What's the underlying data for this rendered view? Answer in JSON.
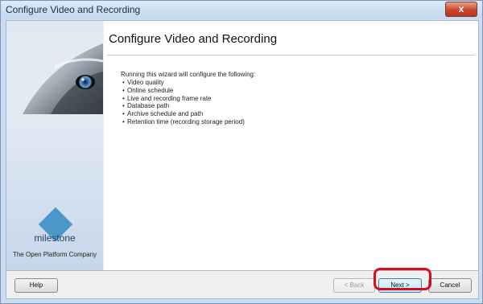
{
  "window": {
    "title": "Configure Video and Recording",
    "close_label": "x"
  },
  "main": {
    "heading": "Configure Video and Recording",
    "intro": "Running this wizard will configure the following:",
    "items": [
      "Video quality",
      "Online schedule",
      "Live and recording frame rate",
      "Database path",
      "Archive schedule and path",
      "Retention time (recording storage period)"
    ]
  },
  "brand": {
    "logo_text": "milestone",
    "tagline": "The Open Platform Company",
    "accent": "#4a97c9"
  },
  "footer": {
    "help_label": "Help",
    "back_label": "< Back",
    "next_label": "Next >",
    "cancel_label": "Cancel"
  },
  "colors": {
    "highlight": "#d40e1f"
  }
}
